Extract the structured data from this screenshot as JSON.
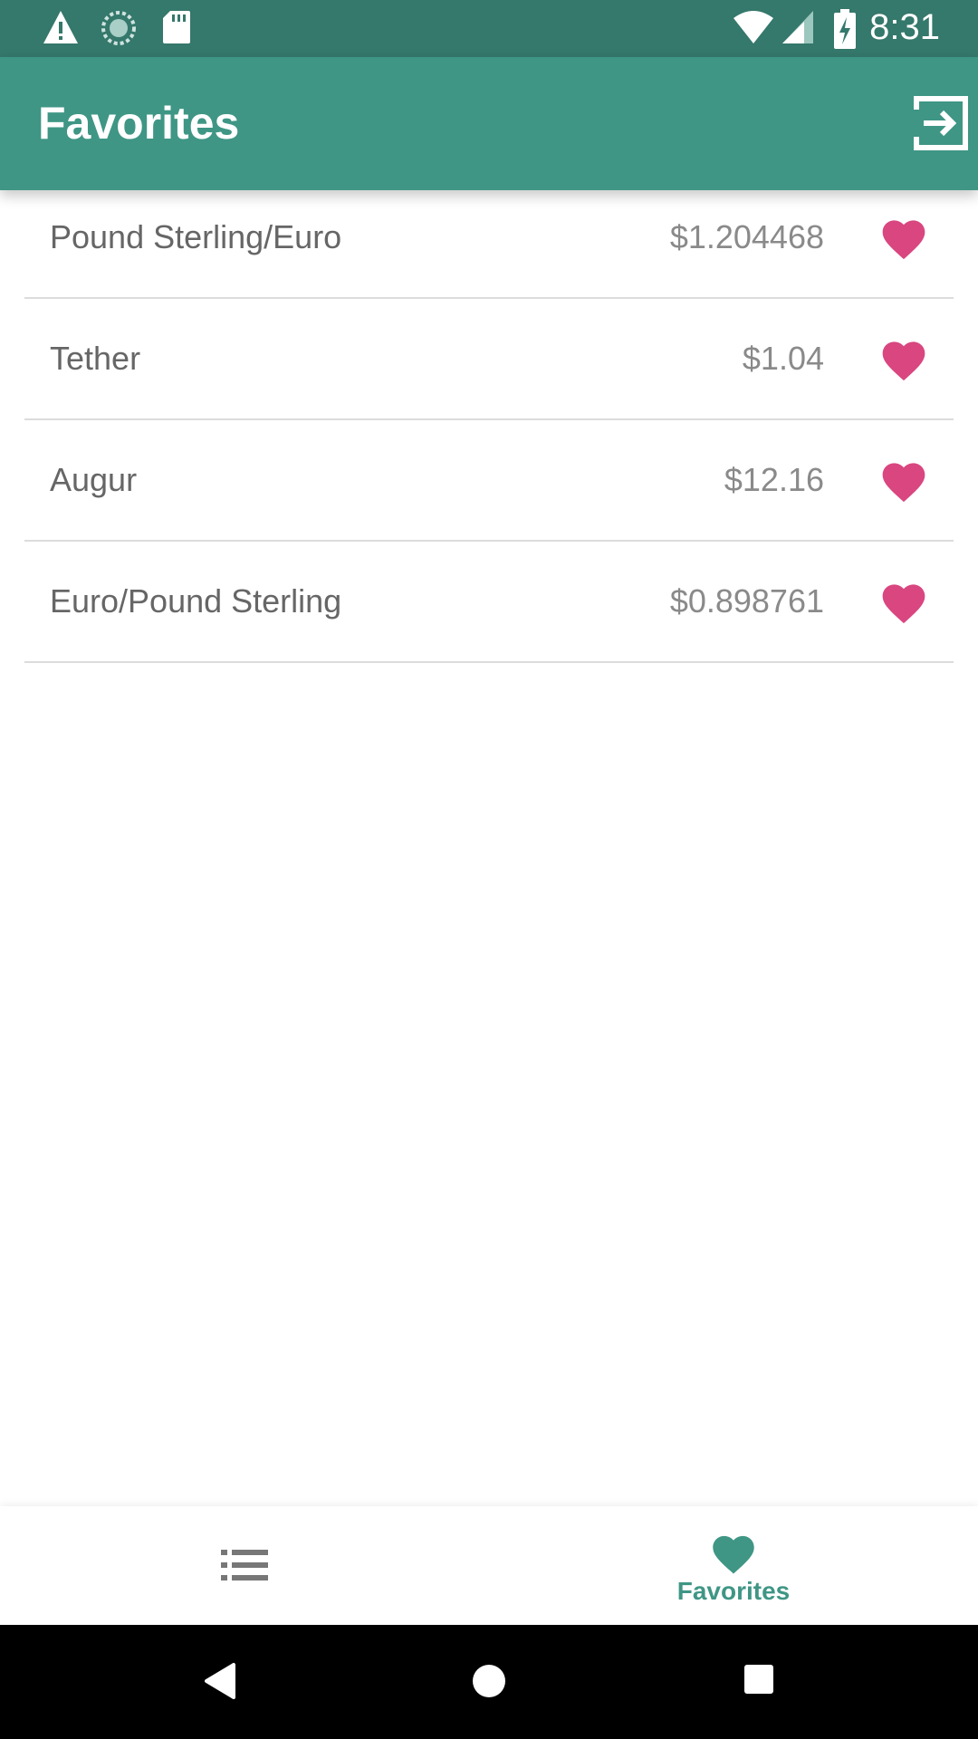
{
  "status_bar": {
    "time": "8:31",
    "left_icons": [
      "warning-icon",
      "sync-icon",
      "sd-card-icon"
    ],
    "right_icons": [
      "wifi-icon",
      "signal-icon",
      "battery-charging-icon"
    ]
  },
  "app_bar": {
    "title": "Favorites",
    "action_icon": "logout-icon"
  },
  "favorites": [
    {
      "name": "Pound Sterling/Euro",
      "price": "$1.204468",
      "favorited": true
    },
    {
      "name": "Tether",
      "price": "$1.04",
      "favorited": true
    },
    {
      "name": "Augur",
      "price": "$12.16",
      "favorited": true
    },
    {
      "name": "Euro/Pound Sterling",
      "price": "$0.898761",
      "favorited": true
    }
  ],
  "bottom_nav": {
    "list_icon": "list-icon",
    "favorites_label": "Favorites",
    "active_tab": "favorites"
  },
  "colors": {
    "status_bar": "#35786c",
    "primary": "#3f9685",
    "heart": "#d94680",
    "text": "#666666"
  }
}
